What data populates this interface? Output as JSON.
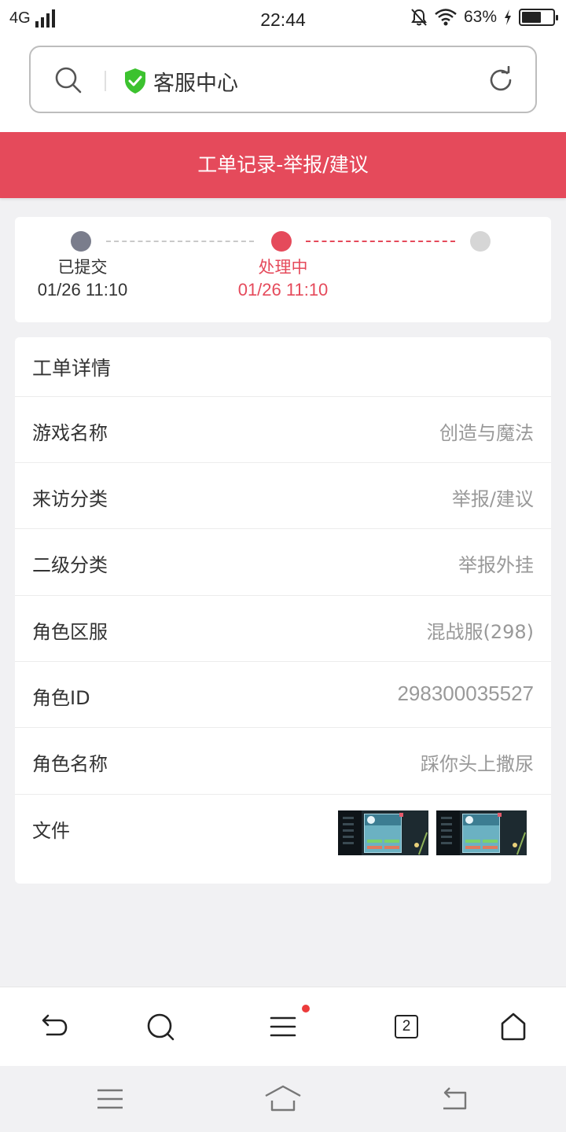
{
  "status_bar": {
    "network": "4G",
    "time": "22:44",
    "battery_percent": "63%",
    "battery_level": 0.63,
    "icons": [
      "signal-icon",
      "bell-off-icon",
      "wifi-icon",
      "charging-icon",
      "battery-icon"
    ]
  },
  "address_bar": {
    "title": "客服中心",
    "secure_icon": "shield-check-icon",
    "shield_color": "#3cc22f"
  },
  "header": {
    "title": "工单记录-举报/建议",
    "bg_color": "#e54a5b"
  },
  "progress": {
    "steps": [
      {
        "name": "已提交",
        "time": "01/26 11:10",
        "state": "done",
        "color": "#7a7d8c"
      },
      {
        "name": "处理中",
        "time": "01/26 11:10",
        "state": "current",
        "color": "#e54a5b"
      },
      {
        "name": "",
        "time": "",
        "state": "pending",
        "color": "#d6d6d6"
      }
    ]
  },
  "detail": {
    "title": "工单详情",
    "rows": [
      {
        "label": "游戏名称",
        "value": "创造与魔法"
      },
      {
        "label": "来访分类",
        "value": "举报/建议"
      },
      {
        "label": "二级分类",
        "value": "举报外挂"
      },
      {
        "label": "角色区服",
        "value": "混战服(298)"
      },
      {
        "label": "角色ID",
        "value": "298300035527"
      },
      {
        "label": "角色名称",
        "value": "踩你头上撒尿"
      }
    ],
    "files": {
      "label": "文件",
      "count": 2
    }
  },
  "toolbar": {
    "tab_count": "2",
    "icons": [
      "back-icon",
      "search-icon",
      "menu-icon",
      "tabs-icon",
      "home-icon"
    ]
  },
  "system_nav": {
    "icons": [
      "recent-apps-icon",
      "home-icon",
      "back-icon"
    ]
  }
}
